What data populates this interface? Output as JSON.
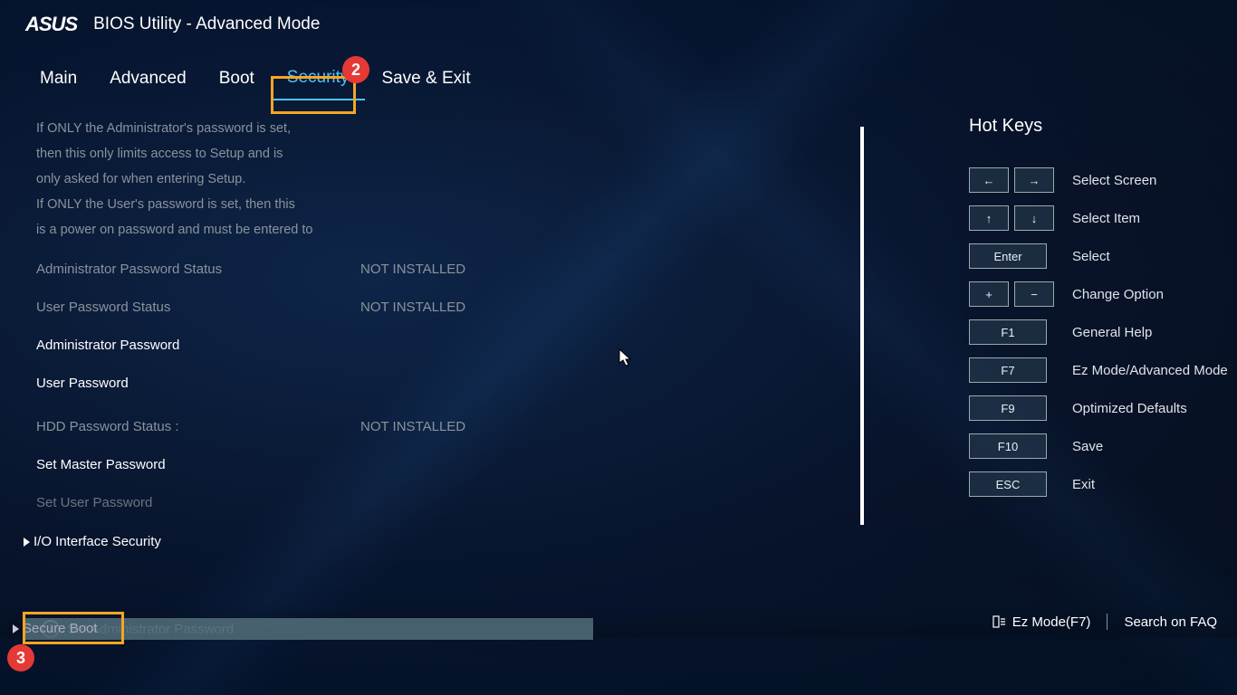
{
  "header": {
    "brand": "ASUS",
    "title": "BIOS Utility - Advanced Mode"
  },
  "tabs": [
    "Main",
    "Advanced",
    "Boot",
    "Security",
    "Save & Exit"
  ],
  "activeTab": 3,
  "callouts": {
    "tab": "2",
    "secureboot": "3"
  },
  "help": {
    "l1": "If ONLY the Administrator's password is set,",
    "l2": "then this only limits access to Setup and is",
    "l3": "only asked for when entering Setup.",
    "l4": "If ONLY the User's password is set, then this",
    "l5": "is a power on password and must be entered to"
  },
  "security": {
    "adminStatusLabel": "Administrator Password Status",
    "adminStatusVal": "NOT INSTALLED",
    "userStatusLabel": "User Password Status",
    "userStatusVal": "NOT INSTALLED",
    "adminPwd": "Administrator Password",
    "userPwd": "User Password",
    "hddStatusLabel": "HDD Password Status  :",
    "hddStatusVal": "NOT INSTALLED",
    "setMaster": "Set Master Password",
    "setUser": "Set User Password",
    "ioSec": "I/O Interface Security",
    "secureBoot": "Secure Boot"
  },
  "infoLine": "Set Administrator Password",
  "hotkeys": {
    "title": "Hot Keys",
    "rows": [
      {
        "keys": [
          "←",
          "→"
        ],
        "label": "Select Screen"
      },
      {
        "keys": [
          "↑",
          "↓"
        ],
        "label": "Select Item"
      },
      {
        "keys": [
          "Enter"
        ],
        "wide": true,
        "label": "Select"
      },
      {
        "keys": [
          "+",
          "−"
        ],
        "label": "Change Option"
      },
      {
        "keys": [
          "F1"
        ],
        "wide": true,
        "label": "General Help"
      },
      {
        "keys": [
          "F7"
        ],
        "wide": true,
        "label": "Ez Mode/Advanced Mode"
      },
      {
        "keys": [
          "F9"
        ],
        "wide": true,
        "label": "Optimized Defaults"
      },
      {
        "keys": [
          "F10"
        ],
        "wide": true,
        "label": "Save"
      },
      {
        "keys": [
          "ESC"
        ],
        "wide": true,
        "label": "Exit"
      }
    ]
  },
  "footer": {
    "ez": "Ez Mode(F7)",
    "faq": "Search on FAQ"
  }
}
